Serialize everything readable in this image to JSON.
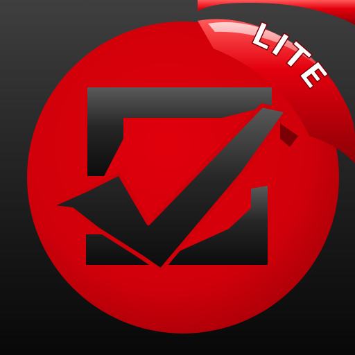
{
  "app_icon": {
    "badge_text": "LITE",
    "icon": "checkmark-in-square-icon",
    "colors": {
      "background_top": "#3f3f3f",
      "background_bottom": "#080808",
      "circle": "#d0000a",
      "ribbon": "#d8000c",
      "ribbon_highlight": "#ff6a6a",
      "badge_text": "#ffffff",
      "glyph_dark": "#0c0c0c",
      "glyph_light": "#5a5a5a"
    }
  }
}
